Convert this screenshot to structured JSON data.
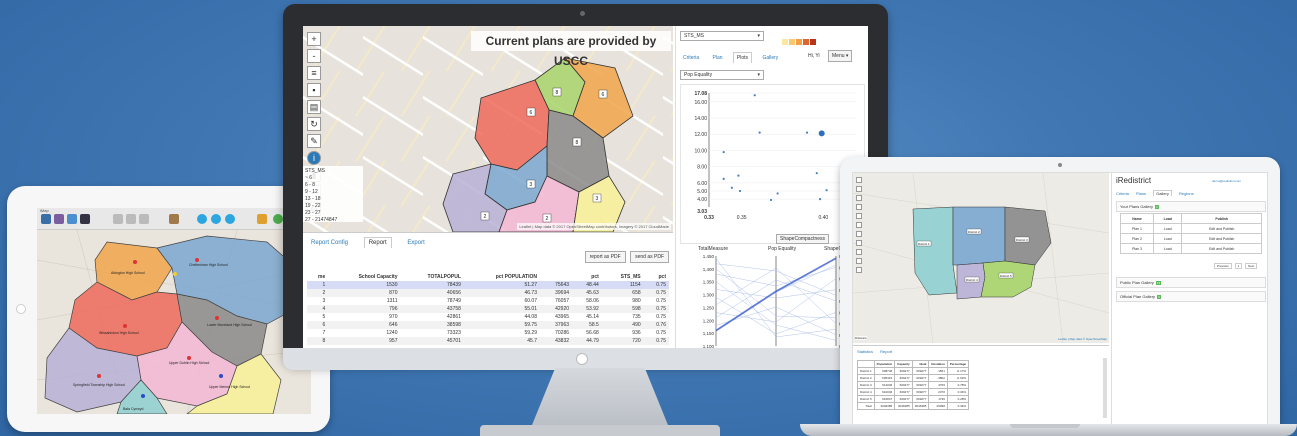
{
  "colors": {
    "background": "#4178b4",
    "district_orange": "#f0a54a",
    "district_red": "#ef6a5a",
    "district_gray": "#8a8a8a",
    "district_blue": "#7aa7cf",
    "district_pink": "#f3b7d3",
    "district_purple": "#b8b0d6",
    "district_yellow": "#f7ef9a",
    "district_green": "#a7d46a",
    "district_teal": "#8fcfd0",
    "accent_link": "#2a7ab8"
  },
  "monitor": {
    "map": {
      "banner": "Current plans are provided by USCC",
      "tools": [
        "+",
        "-"
      ],
      "legend_title": "STS_MS",
      "legend_items": [
        "~ 6",
        "6 - 8",
        "9 - 12",
        "13 - 18",
        "19 - 22",
        "23 - 27",
        "27 - 21474847"
      ],
      "attribution": "Leaflet | Map data © 2017 OpenStreetMap contributors, Imagery © 2017 CloudMade",
      "district_labels": [
        "8",
        "6",
        "6",
        "8",
        "3",
        "3",
        "2",
        "2"
      ]
    },
    "tabs": [
      "Report Config",
      "Report",
      "Export"
    ],
    "report_buttons": [
      "report as PDF",
      "send as PDF"
    ],
    "table": {
      "headers": [
        "me",
        "School Capacity",
        "TOTALPOPUL",
        "pct POPULATION",
        "",
        "pct",
        "STS_MS",
        "pct"
      ],
      "rows": [
        [
          "1",
          "1530",
          "78439",
          "51.27",
          "75643",
          "48.44",
          "1154",
          "0.75"
        ],
        [
          "2",
          "870",
          "40656",
          "46.73",
          "39694",
          "45.63",
          "658",
          "0.75"
        ],
        [
          "3",
          "1311",
          "78749",
          "60.07",
          "76057",
          "58.06",
          "980",
          "0.75"
        ],
        [
          "4",
          "796",
          "43758",
          "55.01",
          "42920",
          "53.92",
          "598",
          "0.75"
        ],
        [
          "5",
          "970",
          "42861",
          "44.08",
          "43965",
          "45.14",
          "735",
          "0.75"
        ],
        [
          "6",
          "646",
          "38598",
          "59.75",
          "37963",
          "58.5",
          "490",
          "0.76"
        ],
        [
          "7",
          "1240",
          "73323",
          "59.29",
          "70286",
          "56.68",
          "936",
          "0.75"
        ],
        [
          "8",
          "957",
          "45701",
          "45.7",
          "43832",
          "44.79",
          "720",
          "0.75"
        ]
      ]
    },
    "panel": {
      "layer_select": "STS_MS",
      "swatches": [
        "#fbe6a2",
        "#f8c870",
        "#f2a043",
        "#e0652c",
        "#b8351a"
      ],
      "tabs": [
        "Criteria",
        "Plan",
        "Plots",
        "Gallery"
      ],
      "active_tab": "Plots",
      "user": "Hi, Yi",
      "menu_label": "Menu ▾",
      "plot_select": "Pop Equality",
      "para_button": "ShapeCompactness"
    }
  },
  "chart_data": [
    {
      "type": "scatter",
      "ylabel": "",
      "xlabel": "",
      "y_ticks": [
        "4.00",
        "5.00",
        "6.00",
        "8.00",
        "10.00",
        "12.00",
        "14.00",
        "16.00",
        "17.08"
      ],
      "y_top_label": "17.08",
      "y_bottom_label": "3.03",
      "x_ticks": [
        "0.33",
        "0.35",
        "0.40",
        "0.42"
      ],
      "ylim": [
        3.03,
        17.08
      ],
      "xlim": [
        0.33,
        0.42
      ],
      "points": [
        {
          "x": 0.339,
          "y": 9.8
        },
        {
          "x": 0.339,
          "y": 6.5
        },
        {
          "x": 0.344,
          "y": 5.4
        },
        {
          "x": 0.348,
          "y": 6.9
        },
        {
          "x": 0.349,
          "y": 5.0
        },
        {
          "x": 0.358,
          "y": 16.8
        },
        {
          "x": 0.361,
          "y": 12.2
        },
        {
          "x": 0.368,
          "y": 3.9
        },
        {
          "x": 0.372,
          "y": 4.7
        },
        {
          "x": 0.39,
          "y": 12.2
        },
        {
          "x": 0.396,
          "y": 7.2
        },
        {
          "x": 0.398,
          "y": 4.0
        },
        {
          "x": 0.399,
          "y": 12.1
        },
        {
          "x": 0.402,
          "y": 5.1
        }
      ],
      "highlight": {
        "x": 0.399,
        "y": 12.1
      }
    },
    {
      "type": "line",
      "axes": [
        "TotalMeasure",
        "Pop Equality",
        "ShapeCompactness"
      ],
      "left_ticks": [
        "1,100",
        "1,150",
        "1,200",
        "1,250",
        "1,300",
        "1,350",
        "1,400",
        "1,450"
      ],
      "right_ticks": [
        "0.34",
        "0.35",
        "0.36",
        "0.37",
        "0.38",
        "0.39",
        "0.40",
        "0.41",
        "0.42"
      ],
      "left_range": [
        1100,
        1450
      ],
      "middle_range": [
        3,
        18
      ],
      "right_range": [
        0.34,
        0.42
      ],
      "lines": [
        {
          "v": [
            1160,
            12.0,
            0.412
          ]
        },
        {
          "v": [
            1180,
            9.5,
            0.35
          ]
        },
        {
          "v": [
            1210,
            14.0,
            0.38
          ]
        },
        {
          "v": [
            1230,
            7.0,
            0.4
          ]
        },
        {
          "v": [
            1260,
            16.0,
            0.36
          ]
        },
        {
          "v": [
            1290,
            5.0,
            0.37
          ]
        },
        {
          "v": [
            1320,
            11.0,
            0.39
          ]
        },
        {
          "v": [
            1350,
            6.5,
            0.345
          ]
        },
        {
          "v": [
            1380,
            13.0,
            0.41
          ]
        },
        {
          "v": [
            1400,
            8.0,
            0.365
          ]
        },
        {
          "v": [
            1420,
            15.5,
            0.385
          ]
        },
        {
          "v": [
            1440,
            4.5,
            0.355
          ]
        }
      ],
      "highlight": {
        "v": [
          1160,
          12.1,
          0.418
        ]
      }
    }
  ],
  "tablet": {
    "window_title": "iMap",
    "school_labels": [
      "Abington High School",
      "Cheltenham High School",
      "Wissahickon High School",
      "Lower Moreland High School",
      "Upper Dublin High School",
      "Springfield Township High School",
      "Bala Cynwyd",
      "Upper Merion High School"
    ]
  },
  "laptop": {
    "title": "iRedistrict",
    "user": "demo@iredistrict.com",
    "tabs": [
      "Criteria",
      "Plans",
      "Gallery",
      "Regions"
    ],
    "sections": {
      "your_plans": "Your Plans Gallery",
      "public_plans": "Public Plan Gallery",
      "official_plans": "Official Plan Gallery"
    },
    "badge_counts": {
      "your_plans": "3",
      "public_plans": "13",
      "official_plans": "0"
    },
    "plans_headers": [
      "Name",
      "Load",
      "Publish"
    ],
    "plans_rows": [
      [
        "Plan 1",
        "Load",
        "Edit and Publish"
      ],
      [
        "Plan 2",
        "Load",
        "Edit and Publish"
      ],
      [
        "Plan 3",
        "Load",
        "Edit and Publish"
      ]
    ],
    "pager": [
      "Previous",
      "1",
      "Next"
    ],
    "bottom_tabs": [
      "Statistics",
      "Report"
    ],
    "map_labels": [
      "District 1",
      "District 2",
      "District 3",
      "District 4",
      "District 5"
    ],
    "stats_headers": [
      "",
      "Population",
      "Capacity",
      "Ideal",
      "Deviation",
      "Percentage"
    ],
    "stats_rows": [
      [
        "District 1",
        "608746",
        "609277",
        "609277",
        "-1561",
        "-0.17%"
      ],
      [
        "District 2",
        "605415",
        "609277",
        "609277",
        "-3862",
        "-0.63%"
      ],
      [
        "District 3",
        "614046",
        "609277",
        "609277",
        "4769",
        "0.78%"
      ],
      [
        "District 4",
        "610046",
        "609277",
        "609277",
        "2370",
        "0.34%"
      ],
      [
        "District 5",
        "610847",
        "609277",
        "609277",
        "1736",
        "0.28%"
      ],
      [
        "Total",
        "3046385",
        "3046385",
        "3046385",
        "20998",
        "0.34%"
      ]
    ],
    "zoom_label": "Distance",
    "attribution": "Leaflet | Map data © OpenStreetMap"
  }
}
